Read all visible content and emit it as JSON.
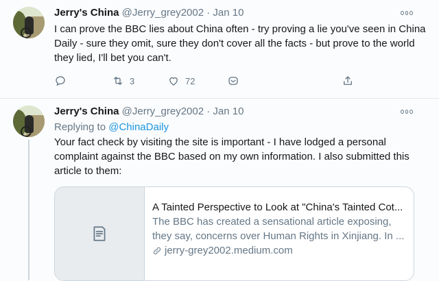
{
  "tweets": [
    {
      "name": "Jerry's China",
      "handle": "@Jerry_grey2002",
      "dot": "·",
      "time": "Jan 10",
      "text": "I can prove the BBC lies about China often - try proving a lie you've seen in China Daily - sure they omit, sure they don't cover all the facts - but prove to the world they lied, I'll bet you can't.",
      "actions": {
        "retweets": "3",
        "likes": "72"
      }
    },
    {
      "name": "Jerry's China",
      "handle": "@Jerry_grey2002",
      "dot": "·",
      "time": "Jan 10",
      "replying_label": "Replying to",
      "replying_to": "@ChinaDaily",
      "text": "Your fact check by visiting the site is important - I have lodged a personal complaint against the BBC based on my own information. I also submitted this article to them:",
      "card": {
        "title": "A Tainted Perspective to Look at \"China's Tainted Cot...",
        "description": "The BBC has created a sensational article exposing, they say, concerns over Human Rights in Xinjiang. In ...",
        "domain": "jerry-grey2002.medium.com"
      }
    }
  ],
  "colors": {
    "accent": "#1b95e0",
    "secondary": "#657786",
    "border": "#ccd6dd"
  }
}
